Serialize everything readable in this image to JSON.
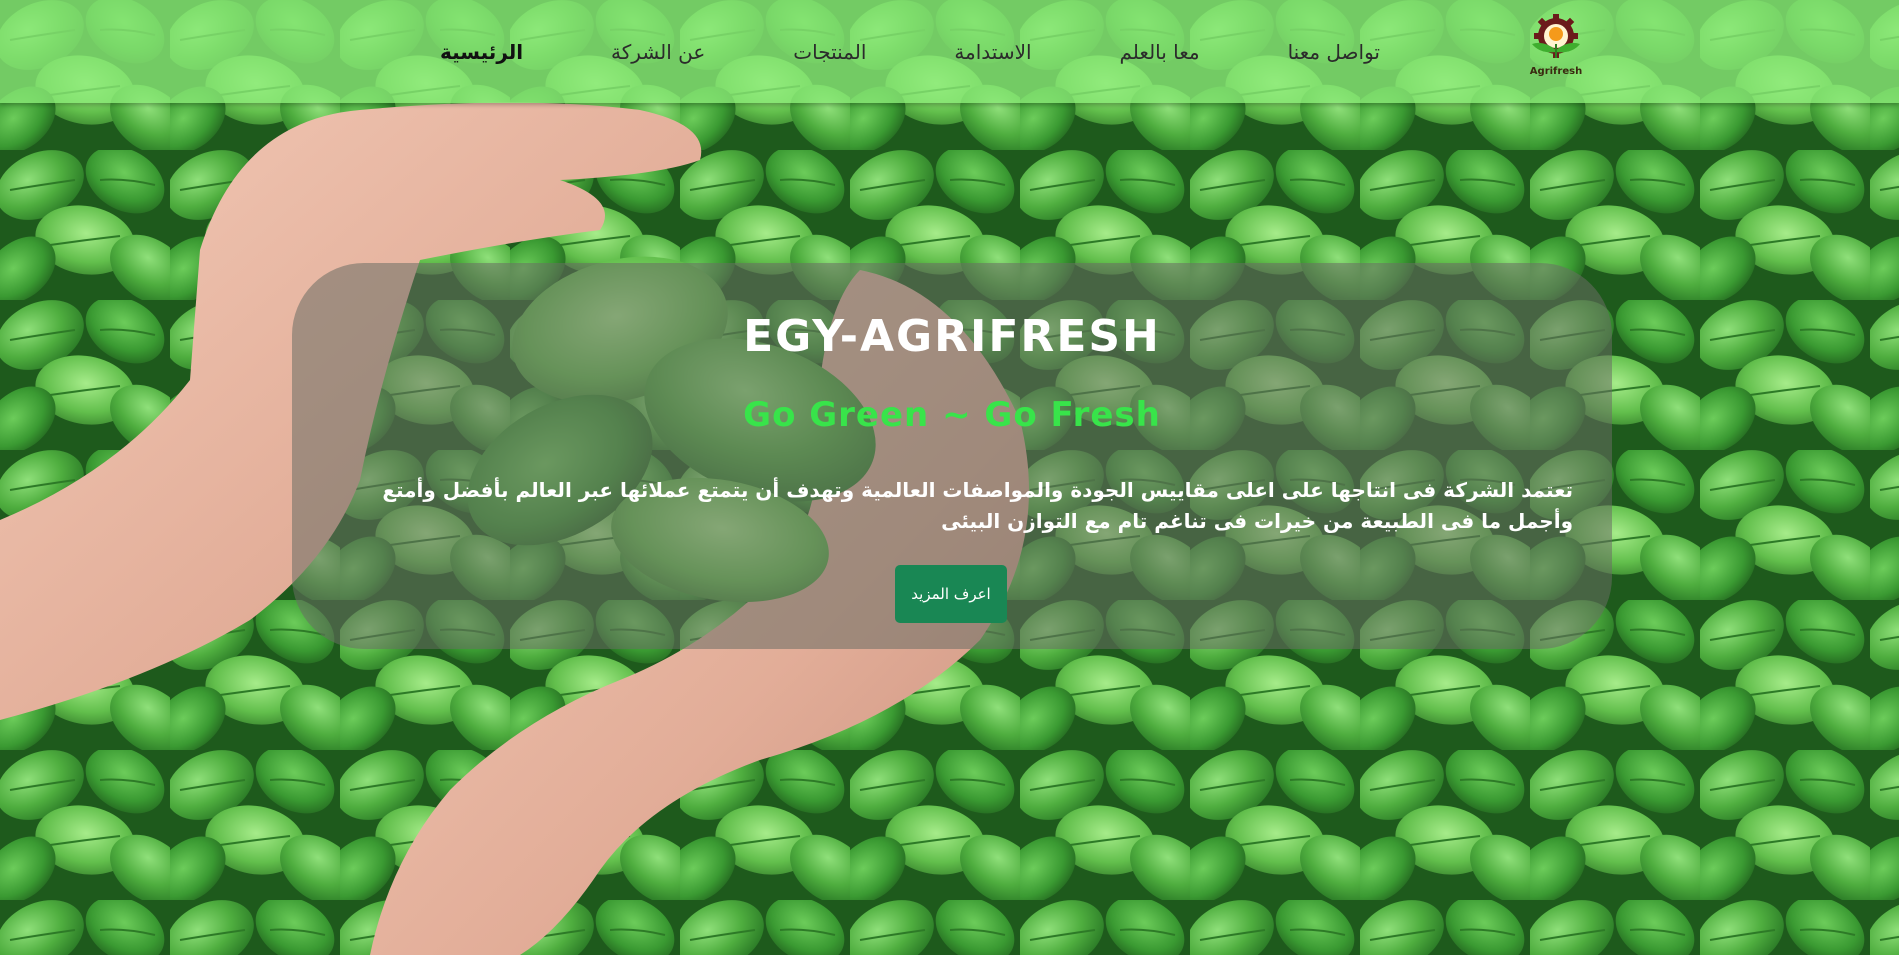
{
  "nav": {
    "items": [
      {
        "label": "الرئيسية",
        "active": true
      },
      {
        "label": "عن الشركة",
        "active": false
      },
      {
        "label": "المنتجات",
        "active": false
      },
      {
        "label": "الاستدامة",
        "active": false
      },
      {
        "label": "معا بالعلم",
        "active": false
      },
      {
        "label": "تواصل معنا",
        "active": false
      }
    ]
  },
  "logo": {
    "icon": "agrifresh-gear-sun-leaves-logo",
    "text": "Agrifresh"
  },
  "hero": {
    "title": "EGY-AGRIFRESH",
    "subtitle": "Go Green ~ Go Fresh",
    "description": "تعتمد الشركة فى انتاجها على اعلى مقاييس الجودة والمواصفات العالمية وتهدف أن يتمتع عملائها عبر العالم بأفضل وأمتع وأجمل ما فى الطبيعة من خيرات فى تناغم تام مع التوازن البيئى",
    "button_label": "اعرف المزيد"
  },
  "background": {
    "image": "hands-holding-mint-leaves-photo"
  },
  "colors": {
    "navbar": "#8ceb78",
    "subtitle": "#38e44a",
    "button": "#198754",
    "overlay": "#696e64"
  }
}
